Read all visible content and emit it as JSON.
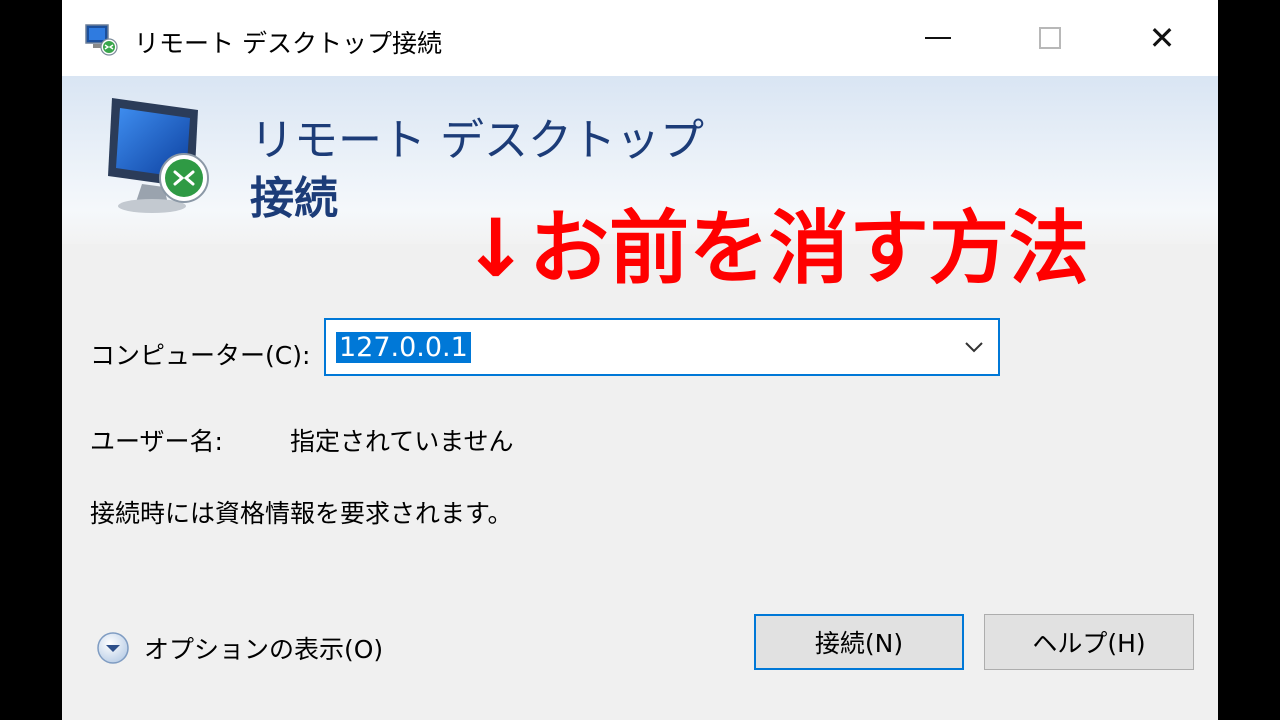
{
  "window": {
    "title": "リモート デスクトップ接続",
    "icon": "remote-desktop-icon",
    "controls": [
      "minimize",
      "maximize",
      "close"
    ],
    "close_glyph": "✕"
  },
  "banner": {
    "line1": "リモート デスクトップ",
    "line2": "接続",
    "icon": "monitor-remote-icon"
  },
  "overlay_text": "↓お前を消す方法",
  "overlay_color": "#ff0000",
  "form": {
    "computer_label": "コンピューター(C):",
    "computer_value": "127.0.0.1",
    "user_label": "ユーザー名:",
    "user_value": "指定されていません",
    "note": "接続時には資格情報を要求されます。"
  },
  "options_label": "オプションの表示(O)",
  "buttons": {
    "connect": "接続(N)",
    "help": "ヘルプ(H)"
  },
  "colors": {
    "accent": "#0078d7",
    "banner_text": "#1c3c78",
    "dialog_bg": "#f0f0f0"
  }
}
